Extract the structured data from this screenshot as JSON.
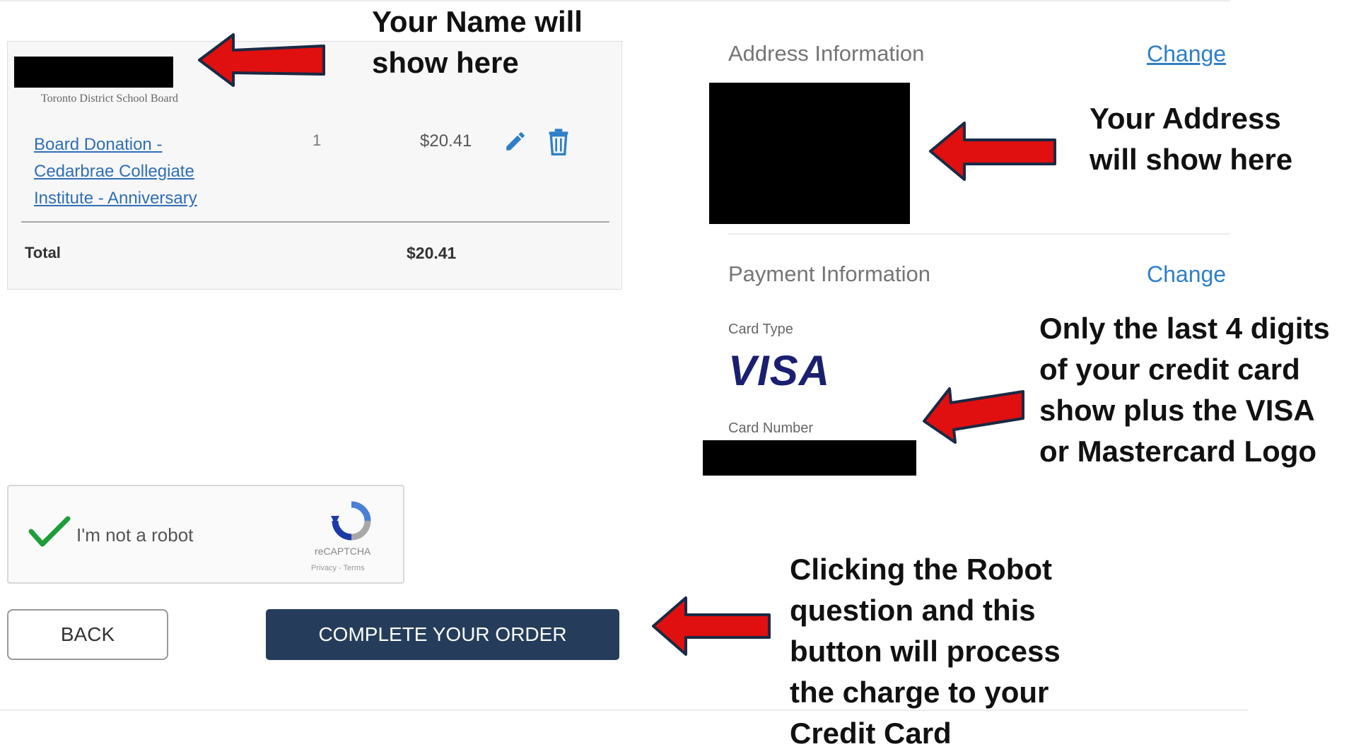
{
  "cart": {
    "org_name": "Toronto District School Board",
    "item_name": "Board Donation - Cedarbrae Collegiate Institute - Anniversary",
    "quantity": "1",
    "price": "$20.41",
    "total_label": "Total",
    "total_value": "$20.41"
  },
  "address": {
    "title": "Address Information",
    "change_label": "Change"
  },
  "payment": {
    "title": "Payment Information",
    "change_label": "Change",
    "card_type_label": "Card Type",
    "card_brand": "VISA",
    "card_number_label": "Card Number"
  },
  "recaptcha": {
    "label": "I'm not a robot",
    "brand": "reCAPTCHA",
    "terms": "Privacy - Terms"
  },
  "buttons": {
    "back": "BACK",
    "complete": "COMPLETE YOUR ORDER"
  },
  "annotations": {
    "name": [
      "Your Name will",
      "show here"
    ],
    "address": [
      "Your Address",
      "will show here"
    ],
    "card": [
      "Only the last 4 digits",
      "of your credit card",
      "show plus the VISA",
      "or Mastercard Logo"
    ],
    "complete": [
      "Clicking the Robot",
      "question and this",
      "button will process",
      "the charge to your",
      "Credit Card"
    ]
  },
  "colors": {
    "link": "#2f6fb5",
    "button_dark": "#253d5b",
    "arrow_red": "#e01010",
    "check_green": "#1e9e3a",
    "visa_blue": "#1a1f71"
  }
}
